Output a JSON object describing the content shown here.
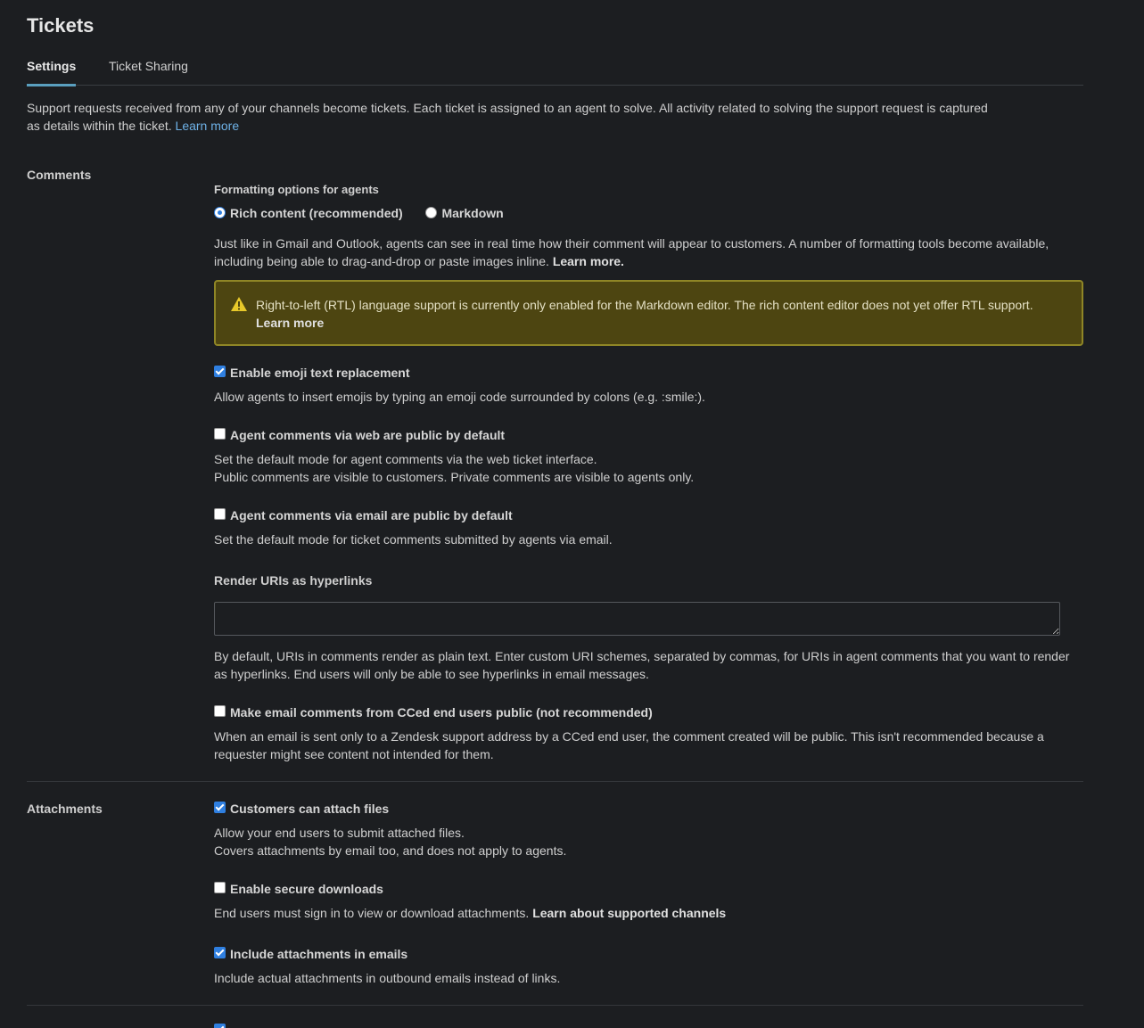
{
  "header": {
    "title": "Tickets"
  },
  "tabs": [
    {
      "label": "Settings",
      "active": true
    },
    {
      "label": "Ticket Sharing",
      "active": false
    }
  ],
  "intro": {
    "text": "Support requests received from any of your channels become tickets. Each ticket is assigned to an agent to solve. All activity related to solving the support request is captured as details within the ticket.",
    "link": "Learn more"
  },
  "comments": {
    "section_label": "Comments",
    "formatting_label": "Formatting options for agents",
    "radio_options": [
      {
        "label": "Rich content (recommended)",
        "selected": true
      },
      {
        "label": "Markdown",
        "selected": false
      }
    ],
    "formatting_desc": "Just like in Gmail and Outlook, agents can see in real time how their comment will appear to customers. A number of formatting tools become available, including being able to drag-and-drop or paste images inline.",
    "formatting_link": "Learn more.",
    "warning": {
      "text": "Right-to-left (RTL) language support is currently only enabled for the Markdown editor. The rich content editor does not yet offer RTL support.",
      "link": "Learn more"
    },
    "emoji": {
      "label": "Enable emoji text replacement",
      "checked": true,
      "desc": "Allow agents to insert emojis by typing an emoji code surrounded by colons (e.g. :smile:)."
    },
    "web_public": {
      "label": "Agent comments via web are public by default",
      "checked": false,
      "desc_line1": "Set the default mode for agent comments via the web ticket interface.",
      "desc_line2": "Public comments are visible to customers. Private comments are visible to agents only."
    },
    "email_public": {
      "label": "Agent comments via email are public by default",
      "checked": false,
      "desc": "Set the default mode for ticket comments submitted by agents via email."
    },
    "uri": {
      "label": "Render URIs as hyperlinks",
      "value": "",
      "desc": "By default, URIs in comments render as plain text. Enter custom URI schemes, separated by commas, for URIs in agent comments that you want to render as hyperlinks. End users will only be able to see hyperlinks in email messages."
    },
    "cc_public": {
      "label": "Make email comments from CCed end users public (not recommended)",
      "checked": false,
      "desc": "When an email is sent only to a Zendesk support address by a CCed end user, the comment created will be public. This isn't recommended because a requester might see content not intended for them."
    }
  },
  "attachments": {
    "section_label": "Attachments",
    "customers_attach": {
      "label": "Customers can attach files",
      "checked": true,
      "desc_line1": "Allow your end users to submit attached files.",
      "desc_line2": "Covers attachments by email too, and does not apply to agents."
    },
    "secure_downloads": {
      "label": "Enable secure downloads",
      "checked": false,
      "desc": "End users must sign in to view or download attachments.",
      "link": "Learn about supported channels"
    },
    "include_emails": {
      "label": "Include attachments in emails",
      "checked": true,
      "desc": "Include actual attachments in outbound emails instead of links."
    }
  },
  "colors": {
    "background": "#1c1e21",
    "accent_tab": "#5a9fbf",
    "link": "#6eb1e6",
    "checkbox_on": "#2f7fe0",
    "warning_bg": "#4d4511",
    "warning_border": "#8f8626"
  }
}
